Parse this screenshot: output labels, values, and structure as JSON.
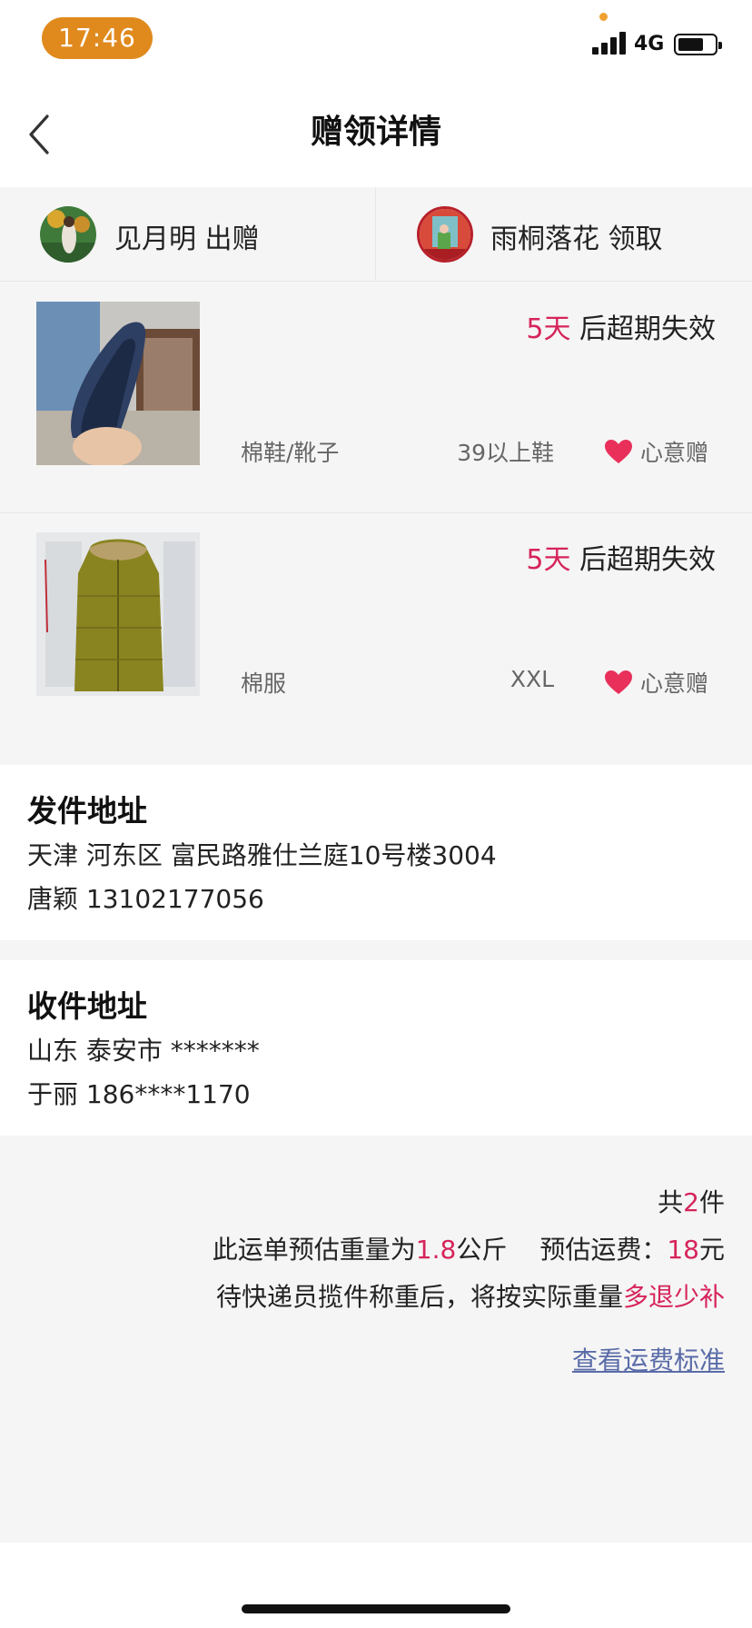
{
  "status_bar": {
    "time": "17:46",
    "network": "4G"
  },
  "nav": {
    "title": "赠领详情"
  },
  "users": {
    "giver": {
      "name": "见月明",
      "action": "出赠"
    },
    "receiver": {
      "name": "雨桐落花",
      "action": "领取"
    }
  },
  "items": [
    {
      "image": "shoe-photo",
      "expire_days": "5天",
      "expire_suffix": " 后超期失效",
      "category": "棉鞋/靴子",
      "size": "39以上鞋",
      "tag": "心意赠"
    },
    {
      "image": "coat-photo",
      "expire_days": "5天",
      "expire_suffix": " 后超期失效",
      "category": "棉服",
      "size": "XXL",
      "tag": "心意赠"
    }
  ],
  "send_address": {
    "title": "发件地址",
    "address": "天津 河东区 富民路雅仕兰庭10号楼3004",
    "contact": "唐颖 13102177056"
  },
  "receive_address": {
    "title": "收件地址",
    "address": "山东 泰安市 *******",
    "contact": "于丽 186****1170"
  },
  "summary": {
    "count_prefix": "共",
    "count": "2",
    "count_suffix": "件",
    "weight_prefix": "此运单预估重量为",
    "weight": "1.8",
    "weight_unit": "公斤",
    "fee_prefix": "预估运费：",
    "fee": "18",
    "fee_unit": "元",
    "note_prefix": "待快递员揽件称重后，将按实际重量",
    "note_highlight": "多退少补",
    "fee_link": "查看运费标准"
  },
  "colors": {
    "accent_red": "#d6245a",
    "time_pill": "#e08a1e",
    "link": "#5a6ca8"
  }
}
